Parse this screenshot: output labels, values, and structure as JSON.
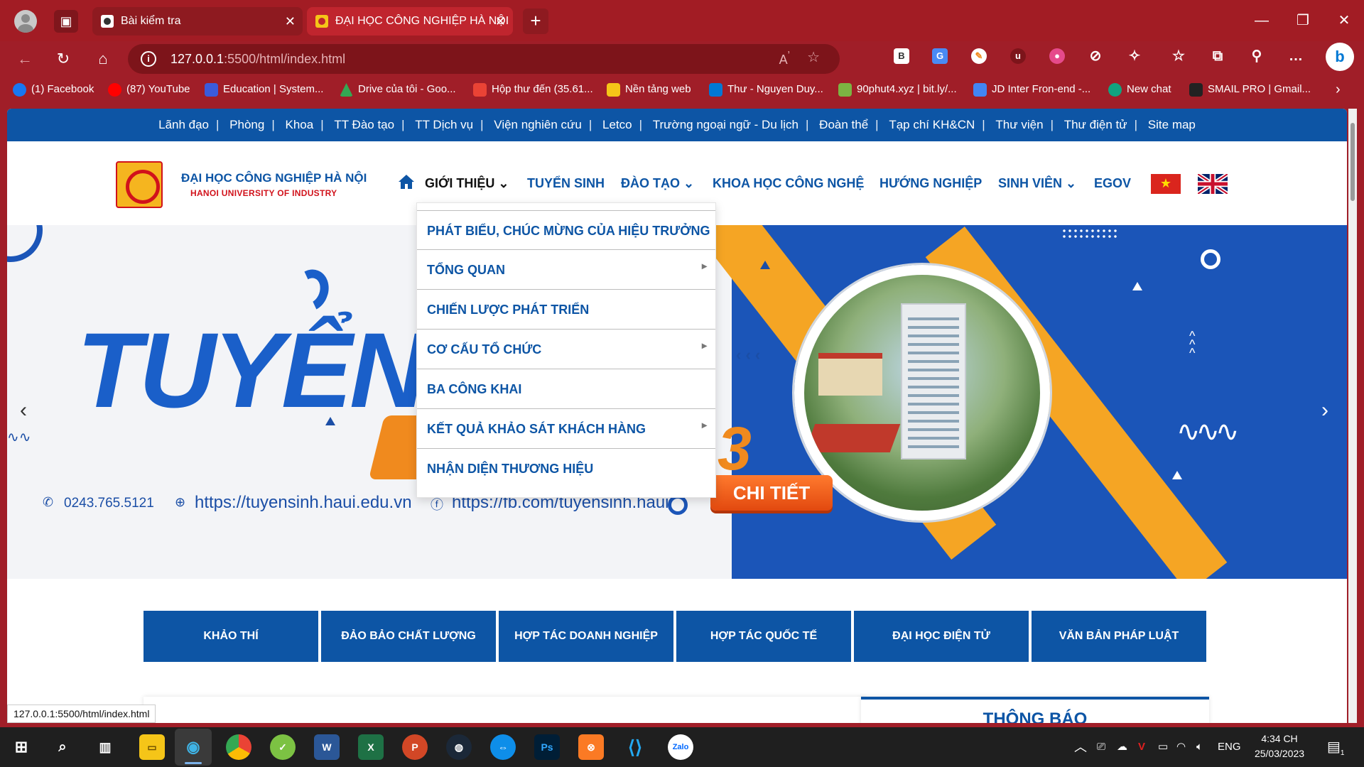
{
  "browser": {
    "tabs": [
      {
        "label": "Bài kiểm tra"
      },
      {
        "label": "ĐẠI HỌC CÔNG NGHIỆP HÀ NỘI"
      }
    ],
    "address": {
      "host": "127.0.0.1",
      "rest": ":5500/html/index.html"
    },
    "bookmarks": [
      {
        "label": "(1) Facebook",
        "color": "#1877f2"
      },
      {
        "label": "(87) YouTube",
        "color": "#ff0000"
      },
      {
        "label": "Education | System...",
        "color": "#3b5bdb"
      },
      {
        "label": "Drive của tôi - Goo...",
        "color": "#34a853"
      },
      {
        "label": "Hộp thư đến (35.61...",
        "color": "#ea4335"
      },
      {
        "label": "Nền tảng web",
        "color": "#f5c518"
      },
      {
        "label": "Thư - Nguyen Duy...",
        "color": "#0078d4"
      },
      {
        "label": "90phut4.xyz | bit.ly/...",
        "color": "#7cb342"
      },
      {
        "label": "JD Inter Fron-end -...",
        "color": "#4285f4"
      },
      {
        "label": "New chat",
        "color": "#10a37f"
      },
      {
        "label": "SMAIL PRO | Gmail...",
        "color": "#222222"
      }
    ],
    "status_url": "127.0.0.1:5500/html/index.html"
  },
  "site": {
    "top_links": [
      "Lãnh đạo",
      "Phòng",
      "Khoa",
      "TT Đào tạo",
      "TT Dịch vụ",
      "Viện nghiên cứu",
      "Letco",
      "Trường ngoại ngữ - Du lịch",
      "Đoàn thể",
      "Tạp chí KH&CN",
      "Thư viện",
      "Thư điện tử",
      "Site map"
    ],
    "brand": {
      "name": "ĐẠI HỌC CÔNG NGHIỆP HÀ NỘI",
      "subtitle": "HANOI UNIVERSITY OF INDUSTRY"
    },
    "nav": [
      "GIỚI THIỆU",
      "TUYỂN SINH",
      "ĐÀO TẠO",
      "KHOA HỌC CÔNG NGHỆ",
      "HƯỚNG NGHIỆP",
      "SINH VIÊN",
      "EGOV"
    ],
    "dropdown": [
      {
        "label": "PHÁT BIỂU, CHÚC MỪNG CỦA HIỆU TRƯỞNG",
        "submenu": false
      },
      {
        "label": "TỔNG QUAN",
        "submenu": true
      },
      {
        "label": "CHIẾN LƯỢC PHÁT TRIỂN",
        "submenu": false
      },
      {
        "label": "CƠ CẤU TỔ CHỨC",
        "submenu": true
      },
      {
        "label": "BA CÔNG KHAI",
        "submenu": false
      },
      {
        "label": "KẾT QUẢ KHẢO SÁT KHÁCH HÀNG",
        "submenu": true
      },
      {
        "label": "NHẬN DIỆN THƯƠNG HIỆU",
        "submenu": false
      }
    ],
    "banner": {
      "headline": "TUYỂN",
      "phone": "0243.765.5121",
      "web": "https://tuyensinh.haui.edu.vn",
      "fb": "https://fb.com/tuyensinh.haui",
      "cta": "CHI TIẾT",
      "year_digit": "3"
    },
    "quick_links": [
      "KHẢO THÍ",
      "ĐẢO BẢO CHẤT LƯỢNG",
      "HỢP TÁC DOANH NGHIỆP",
      "HỢP TÁC QUỐC TẾ",
      "ĐẠI HỌC ĐIỆN TỬ",
      "VĂN BẢN PHÁP LUẬT"
    ],
    "notice_title": "THÔNG BÁO"
  },
  "taskbar": {
    "lang": "ENG",
    "time": "4:34 CH",
    "date": "25/03/2023",
    "notification_count": "1"
  },
  "colors": {
    "browser_red": "#a21c24",
    "site_blue": "#0d55a5",
    "accent_orange": "#f5a524"
  }
}
